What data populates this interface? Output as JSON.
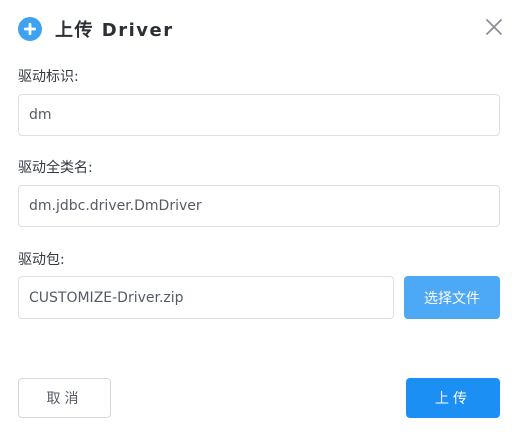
{
  "dialog": {
    "title": "上传 Driver",
    "title_icon": "plus-circle-icon",
    "close_icon": "close-icon"
  },
  "form": {
    "driver_id": {
      "label": "驱动标识:",
      "value": "dm"
    },
    "driver_class": {
      "label": "驱动全类名:",
      "value": "dm.jdbc.driver.DmDriver"
    },
    "driver_package": {
      "label": "驱动包:",
      "value": "CUSTOMIZE-Driver.zip",
      "choose_file_label": "选择文件"
    }
  },
  "footer": {
    "cancel_label": "取消",
    "upload_label": "上传"
  },
  "colors": {
    "accent": "#1c8ff5",
    "file_button": "#4da8f6",
    "icon": "#3fa2f0"
  }
}
